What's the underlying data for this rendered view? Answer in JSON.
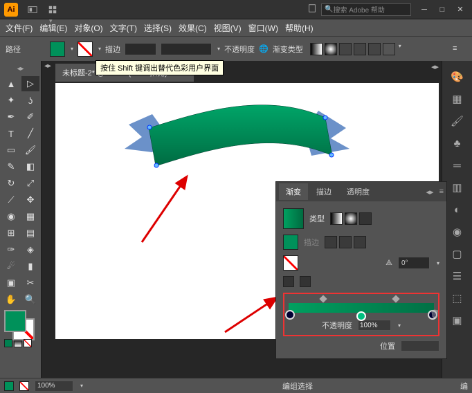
{
  "titlebar": {
    "search_placeholder": "搜索 Adobe 帮助",
    "logo": "Ai"
  },
  "menubar": {
    "file": "文件(F)",
    "edit": "编辑(E)",
    "object": "对象(O)",
    "type": "文字(T)",
    "select": "选择(S)",
    "effect": "效果(C)",
    "view": "视图(V)",
    "window": "窗口(W)",
    "help": "帮助(H)"
  },
  "controlbar": {
    "mode": "路径",
    "stroke": "描边",
    "opacity": "不透明度",
    "gradtype": "渐变类型",
    "tooltip_text": "按住 Shift 键调出替代色彩用户界面"
  },
  "doc": {
    "tab_title": "未标题-2* @ 100% (RGB/预览)"
  },
  "panel": {
    "tab_gradient": "渐变",
    "tab_stroke": "描边",
    "tab_transparency": "透明度",
    "type_label": "类型",
    "stroke_label": "描边",
    "angle_value": "0°",
    "opacity_label": "不透明度",
    "opacity_value": "100%",
    "position_label": "位置"
  },
  "status": {
    "zoom": "100%",
    "text": "编组选择",
    "right": "编"
  },
  "colors": {
    "green": "#00915a",
    "accent": "#6b91c9"
  }
}
